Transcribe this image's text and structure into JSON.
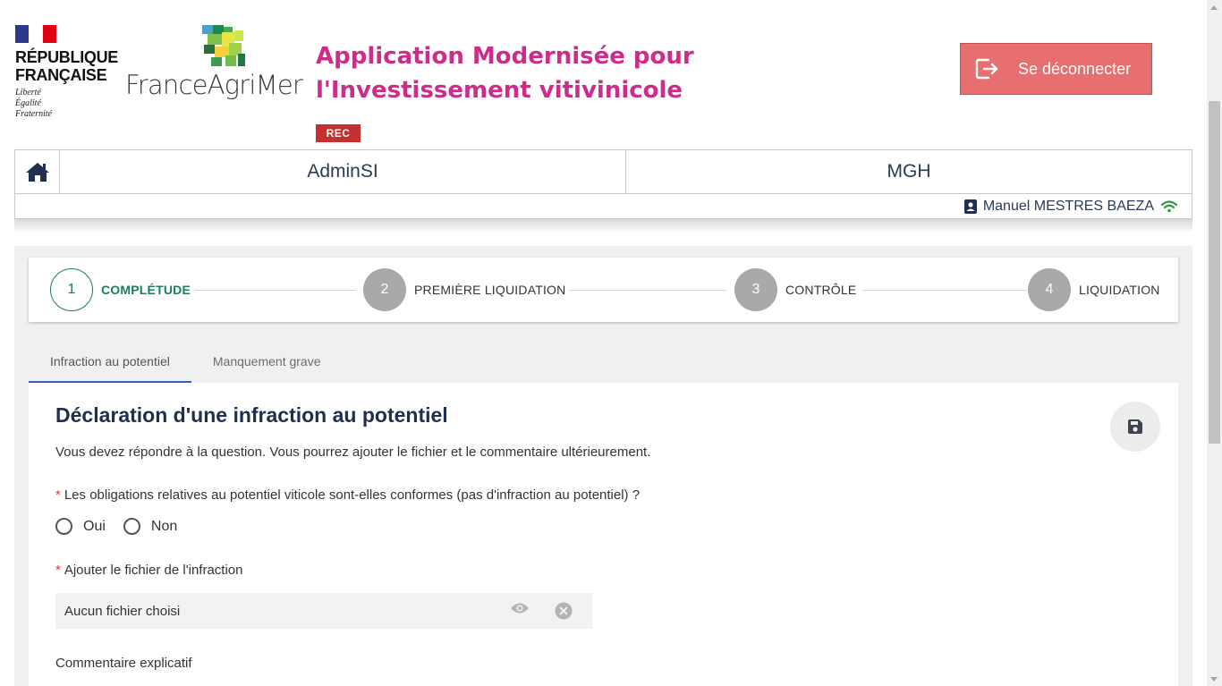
{
  "header": {
    "republique_line1": "RÉPUBLIQUE",
    "republique_line2": "FRANÇAISE",
    "devise": [
      "Liberté",
      "Égalité",
      "Fraternité"
    ],
    "agency_name": "FranceAgriMer",
    "app_title": "Application Modernisée pour l'Investissement vitivinicole",
    "env_badge": "REC",
    "logout_label": "Se déconnecter"
  },
  "nav": {
    "home_icon": "home-icon",
    "items": [
      {
        "label": "AdminSI"
      },
      {
        "label": "MGH"
      }
    ],
    "user_name": "Manuel MESTRES BAEZA",
    "user_icon": "user-badge-icon",
    "connection_icon": "wifi-icon"
  },
  "stepper": {
    "steps": [
      {
        "number": "1",
        "label": "COMPLÉTUDE",
        "state": "active"
      },
      {
        "number": "2",
        "label": "PREMIÈRE LIQUIDATION",
        "state": "todo"
      },
      {
        "number": "3",
        "label": "CONTRÔLE",
        "state": "todo"
      },
      {
        "number": "4",
        "label": "LIQUIDATION",
        "state": "todo"
      }
    ]
  },
  "tabs": [
    {
      "label": "Infraction au potentiel",
      "active": true
    },
    {
      "label": "Manquement grave",
      "active": false
    }
  ],
  "form": {
    "title": "Déclaration d'une infraction au potentiel",
    "info": "Vous devez répondre à la question. Vous pourrez ajouter le fichier et le commentaire ultérieurement.",
    "required_mark": "*",
    "question": "Les obligations relatives au potentiel viticole sont-elles conformes (pas d'infraction au potentiel) ?",
    "options": [
      {
        "label": "Oui"
      },
      {
        "label": "Non"
      }
    ],
    "file_label": "Ajouter le fichier de l'infraction",
    "file_value": "Aucun fichier choisi",
    "comment_label": "Commentaire explicatif"
  },
  "colors": {
    "title_pink": "#cc2d8a",
    "logout_red": "#e76f6f",
    "badge_red": "#c62f2f",
    "step_green": "#1f7a60",
    "navy": "#1f2f4d",
    "wifi_green": "#2e9a3e"
  }
}
